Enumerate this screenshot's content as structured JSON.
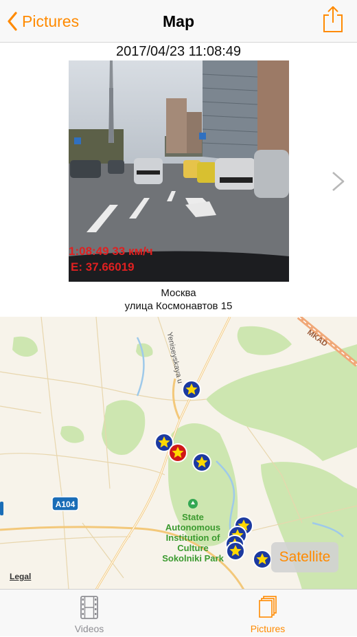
{
  "nav": {
    "back_label": "Pictures",
    "title": "Map"
  },
  "photo": {
    "timestamp": "2017/04/23 11:08:49",
    "overlay_line1": "1:08:49 33 км/ч",
    "overlay_line2": "E: 37.66019"
  },
  "address": {
    "city": "Москва",
    "street": "улица Космонавтов 15"
  },
  "map": {
    "road_labels": {
      "mkad": "MKAD",
      "street": "Yeniseyskaya u",
      "route": "A104"
    },
    "park_label": [
      "State",
      "Autonomous",
      "Institution of",
      "Culture",
      "Sokolniki Park"
    ],
    "legal": "Legal",
    "satellite_button": "Satellite"
  },
  "tabs": [
    {
      "label": "Videos",
      "selected": false
    },
    {
      "label": "Pictures",
      "selected": true
    }
  ],
  "colors": {
    "accent": "#ff8a00",
    "inactive": "#8e8e93",
    "marker_blue": "#1c3aa0",
    "marker_red": "#d01818",
    "star": "#ffd800"
  }
}
